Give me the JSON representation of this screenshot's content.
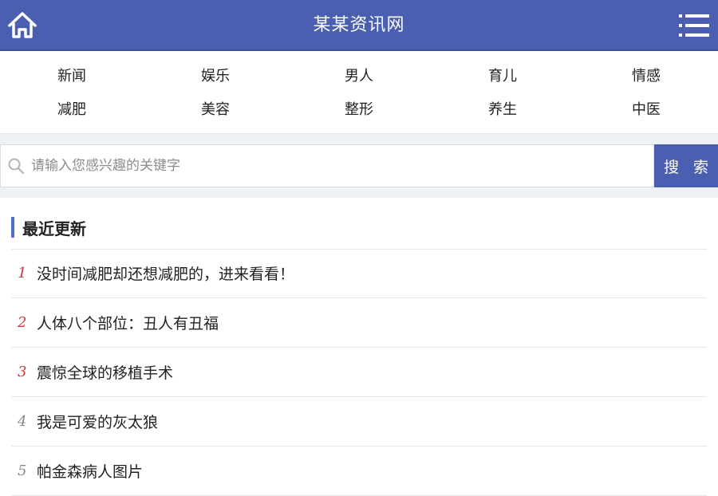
{
  "header": {
    "title": "某某资讯网",
    "home_icon": "home-icon",
    "menu_icon": "menu-icon",
    "bg_color": "#4a5fb0"
  },
  "nav": {
    "items": [
      {
        "label": "新闻"
      },
      {
        "label": "娱乐"
      },
      {
        "label": "男人"
      },
      {
        "label": "育儿"
      },
      {
        "label": "情感"
      },
      {
        "label": "减肥"
      },
      {
        "label": "美容"
      },
      {
        "label": "整形"
      },
      {
        "label": "养生"
      },
      {
        "label": "中医"
      }
    ]
  },
  "search": {
    "placeholder": "请输入您感兴趣的关键字",
    "value": "",
    "button_label": "搜 索",
    "icon": "search-icon"
  },
  "latest": {
    "title": "最近更新",
    "accent_color": "#4a6fcf",
    "items": [
      {
        "rank": "1",
        "title": "没时间减肥却还想减肥的，进来看看！",
        "hot": true
      },
      {
        "rank": "2",
        "title": "人体八个部位：丑人有丑福",
        "hot": true
      },
      {
        "rank": "3",
        "title": "震惊全球的移植手术",
        "hot": true
      },
      {
        "rank": "4",
        "title": "我是可爱的灰太狼",
        "hot": false
      },
      {
        "rank": "5",
        "title": "帕金森病人图片",
        "hot": false
      }
    ]
  }
}
